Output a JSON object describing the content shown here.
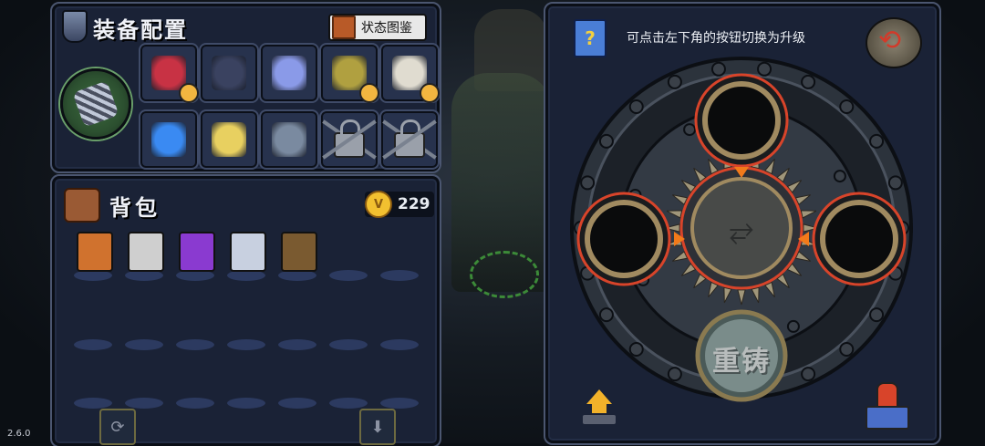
{
  "version": "2.6.0",
  "equipment": {
    "title": "装备配置",
    "status_button": "状态图鉴",
    "slots": [
      {
        "name": "red-amulet",
        "color": "#c83244",
        "upgrade": true
      },
      {
        "name": "dark-hood-figure",
        "color": "#3a4260",
        "upgrade": false
      },
      {
        "name": "crystal-orb",
        "color": "#8a9ae8",
        "upgrade": false
      },
      {
        "name": "golden-mask",
        "color": "#b0a040",
        "upgrade": true
      },
      {
        "name": "white-horn-pendant",
        "color": "#e0dcd0",
        "upgrade": true
      },
      {
        "name": "blue-gem-pendant",
        "color": "#3a8af2",
        "upgrade": false
      },
      {
        "name": "torch-pair",
        "color": "#e8d060",
        "upgrade": false
      },
      {
        "name": "battery-device",
        "color": "#7a8aa0",
        "upgrade": false
      },
      {
        "name": "locked-slot",
        "locked": true
      },
      {
        "name": "locked-slot",
        "locked": true
      }
    ]
  },
  "backpack": {
    "title": "背包",
    "coins": "229",
    "coin_symbol": "V",
    "items": [
      {
        "name": "recipe-scroll-orange",
        "color": "#d0722e"
      },
      {
        "name": "skull-scroll",
        "color": "#cfcfcf"
      },
      {
        "name": "purple-rune-disc",
        "color": "#8a3ad0"
      },
      {
        "name": "compass",
        "color": "#c8d0e0"
      },
      {
        "name": "wooden-totem",
        "color": "#7a5a30"
      }
    ]
  },
  "forge": {
    "hint": "可点击左下角的按钮切换为升级",
    "hint_icon": "?",
    "reforge_label": "重铸"
  },
  "colors": {
    "panel_bg": "#1a2236",
    "accent_red": "#d83a2a",
    "accent_orange": "#f27a1a",
    "gold": "#f2c030"
  }
}
